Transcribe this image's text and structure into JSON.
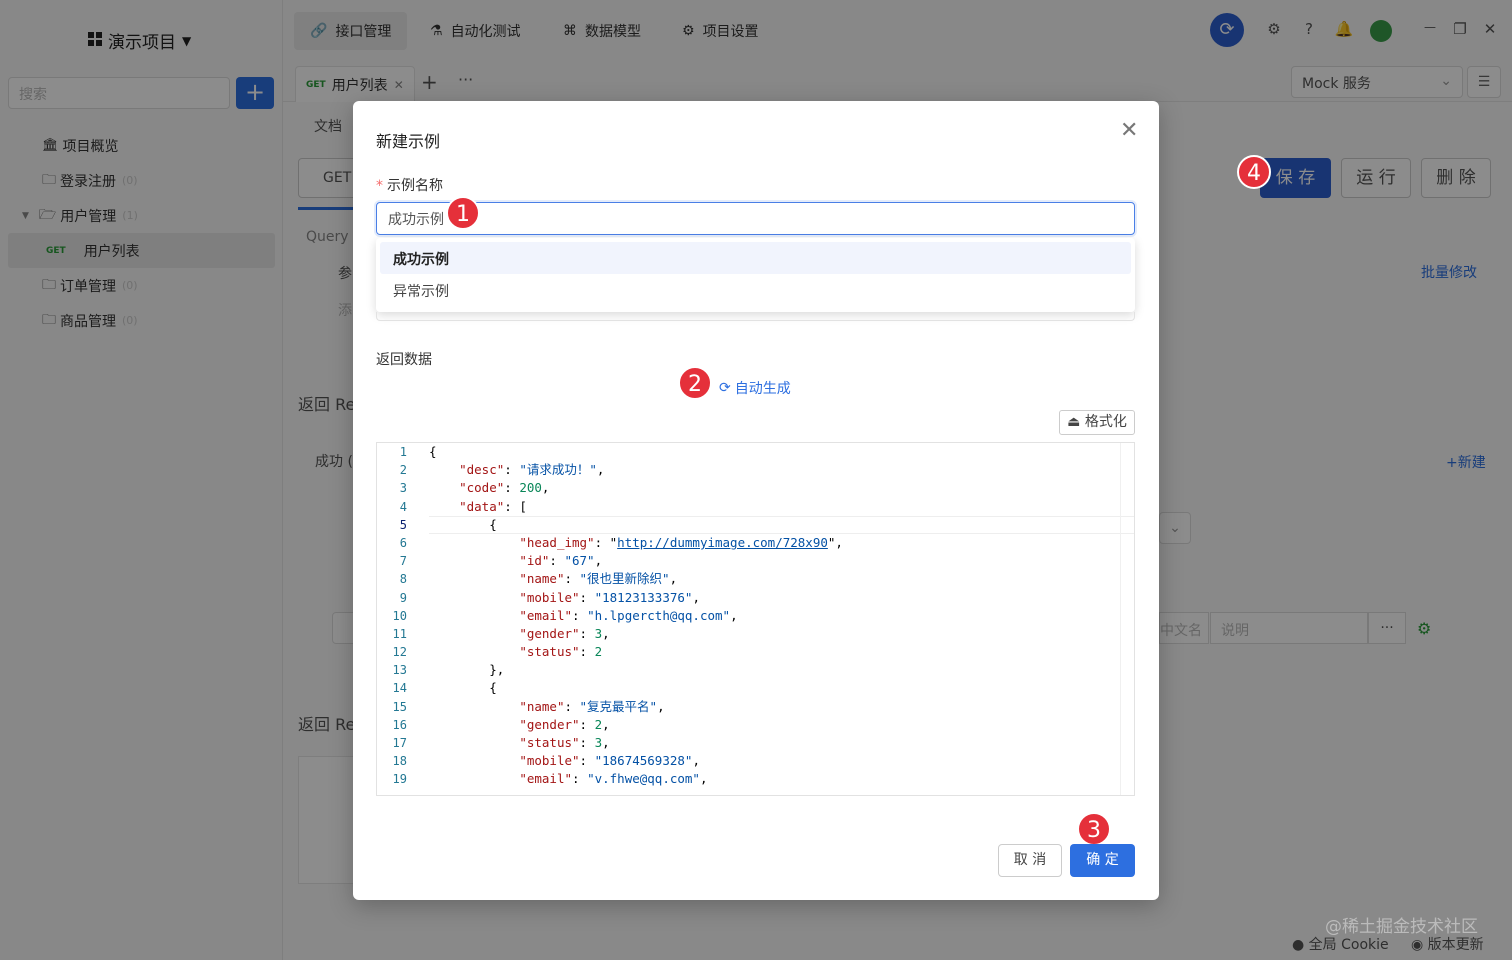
{
  "app": {
    "project_name": "演示项目",
    "search_placeholder": "搜索",
    "sidebar": [
      {
        "label": "项目概览",
        "icon": "bank-icon",
        "count": ""
      },
      {
        "label": "登录注册",
        "icon": "folder-icon",
        "count": "(0)"
      },
      {
        "label": "用户管理",
        "icon": "folder-icon",
        "count": "(1)"
      },
      {
        "label": "用户列表",
        "method": "GET",
        "count": ""
      },
      {
        "label": "订单管理",
        "icon": "folder-icon",
        "count": "(0)"
      },
      {
        "label": "商品管理",
        "icon": "folder-icon",
        "count": "(0)"
      }
    ],
    "top_tabs": [
      "接口管理",
      "自动化测试",
      "数据模型",
      "项目设置"
    ],
    "api_tab": {
      "method": "GET",
      "label": "用户列表"
    },
    "mock_service": "Mock 服务",
    "doc_tab": "文档",
    "method": "GET",
    "query_label": "Query 参",
    "param_col": "参",
    "add_param": "添",
    "batch_edit": "批量修改",
    "response_title": "返回 Re",
    "success_label": "成功 (",
    "new_link": "+新建",
    "response_title2": "返回 Re",
    "field_name": "中文名",
    "field_desc": "说明",
    "save": "保 存",
    "run": "运 行",
    "delete": "删 除",
    "footer_cookie": "全局 Cookie",
    "footer_update": "版本更新",
    "watermark": "@稀土掘金技术社区"
  },
  "modal": {
    "title": "新建示例",
    "name_label": "示例名称",
    "name_value": "成功示例",
    "options": [
      "成功示例",
      "异常示例"
    ],
    "data_label": "返回数据",
    "auto_generate": "自动生成",
    "format_button": "格式化",
    "cancel": "取 消",
    "confirm": "确 定",
    "badges": [
      "1",
      "2",
      "3",
      "4"
    ]
  },
  "code_lines": [
    "{",
    "    \"desc\": \"请求成功！\",",
    "    \"code\": 200,",
    "    \"data\": [",
    "        {",
    "            \"head_img\": \"http://dummyimage.com/728x90\",",
    "            \"id\": \"67\",",
    "            \"name\": \"很也里新除织\",",
    "            \"mobile\": \"18123133376\",",
    "            \"email\": \"h.lpgercth@qq.com\",",
    "            \"gender\": 3,",
    "            \"status\": 2",
    "        },",
    "        {",
    "            \"name\": \"复克最平名\",",
    "            \"gender\": 2,",
    "            \"status\": 3,",
    "            \"mobile\": \"18674569328\",",
    "            \"email\": \"v.fhwe@qq.com\","
  ]
}
